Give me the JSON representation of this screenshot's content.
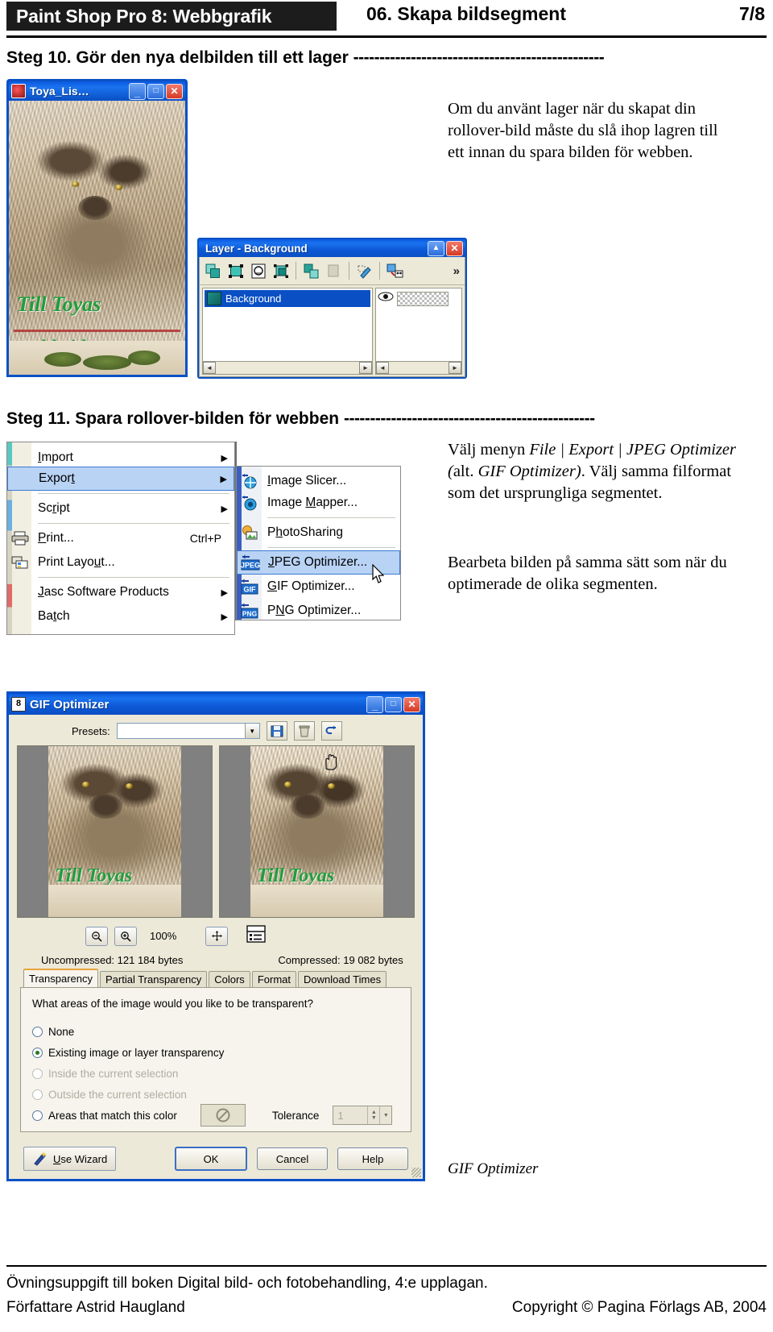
{
  "header": {
    "badge_title": "Paint Shop Pro 8: Webbgrafik",
    "chapter": "06. Skapa bildsegment",
    "page_number": "7/8"
  },
  "step10": {
    "title": "Steg 10. Gör den nya delbilden till ett lager",
    "dashes": "------------------------------------------------",
    "body": "Om du använt lager när du skapat din rollover-bild måste du slå ihop lagren till ett innan du spara bilden för webben."
  },
  "step11": {
    "title": "Steg 11. Spara rollover-bilden för webben",
    "dashes": "------------------------------------------------",
    "para1_pre": "Välj menyn ",
    "para1_menu": "File | Export | JPEG Optimizer (",
    "para1_alt": "alt. ",
    "para1_menu2": "GIF Optimizer)",
    "para1_post": ". Välj samma filformat som det ursprungliga segmentet.",
    "para2": "Bearbeta bilden på samma sätt som när du optimerade de olika segmenten."
  },
  "toya_window": {
    "title": "Toya_Lis…",
    "text_line1": "Till Toyas",
    "text_line2": "webbsida",
    "minimize": "_",
    "maximize": "□",
    "close": "✕"
  },
  "layer_palette": {
    "title": "Layer - Background",
    "layer_name": "Background",
    "rollup": "▲",
    "close": "✕",
    "overflow": "»"
  },
  "file_menu": {
    "items": [
      {
        "label": "Import",
        "submenu": true,
        "accel": "",
        "selected": false
      },
      {
        "label": "Export",
        "submenu": true,
        "accel": "",
        "selected": true
      },
      {
        "label": "Script",
        "submenu": true,
        "accel": "",
        "selected": false
      },
      {
        "label": "Print...",
        "submenu": false,
        "accel": "Ctrl+P",
        "selected": false
      },
      {
        "label": "Print Layout...",
        "submenu": false,
        "accel": "",
        "selected": false
      },
      {
        "label": "Jasc Software Products",
        "submenu": true,
        "accel": "",
        "selected": false
      },
      {
        "label": "Batch",
        "submenu": true,
        "accel": "",
        "selected": false
      }
    ]
  },
  "export_menu": {
    "items": [
      {
        "label": "Image Slicer...",
        "icon": "slicer-icon",
        "selected": false
      },
      {
        "label": "Image Mapper...",
        "icon": "mapper-icon",
        "selected": false
      },
      {
        "label": "PhotoSharing",
        "icon": "photosharing-icon",
        "selected": false
      },
      {
        "label": "JPEG Optimizer...",
        "icon": "jpeg-icon",
        "selected": true
      },
      {
        "label": "GIF Optimizer...",
        "icon": "gif-icon",
        "selected": false
      },
      {
        "label": "PNG Optimizer...",
        "icon": "png-icon",
        "selected": false
      }
    ],
    "badge_jpeg": "JPEG",
    "badge_gif": "GIF",
    "badge_png": "PNG"
  },
  "gif_dialog": {
    "title": "GIF Optimizer",
    "minimize": "_",
    "maximize": "□",
    "close": "✕",
    "presets_label": "Presets:",
    "presets_value": "",
    "zoom_out": "−",
    "zoom_in": "+",
    "zoom_level": "100%",
    "pan": "✛",
    "uncompressed": "Uncompressed:  121 184 bytes",
    "compressed": "Compressed: 19 082 bytes",
    "tabs": [
      "Transparency",
      "Partial Transparency",
      "Colors",
      "Format",
      "Download Times"
    ],
    "active_tab": "Transparency",
    "question": "What areas of the image would you like to be transparent?",
    "options": [
      {
        "label": "None",
        "checked": false,
        "disabled": false
      },
      {
        "label": "Existing image or layer transparency",
        "checked": true,
        "disabled": false
      },
      {
        "label": "Inside the current selection",
        "checked": false,
        "disabled": true
      },
      {
        "label": "Outside the current selection",
        "checked": false,
        "disabled": true
      },
      {
        "label": "Areas that match this color",
        "checked": false,
        "disabled": false
      }
    ],
    "tolerance_label": "Tolerance",
    "tolerance_value": "1",
    "use_wizard": "Use Wizard",
    "ok": "OK",
    "cancel": "Cancel",
    "help": "Help",
    "preview_text": "Till Toyas"
  },
  "caption": "GIF Optimizer",
  "footer": {
    "line1": "Övningsuppgift till boken Digital bild- och fotobehandling, 4:e upplagan.",
    "author": "Författare Astrid Haugland",
    "copyright": "Copyright © Pagina Förlags AB, 2004"
  }
}
